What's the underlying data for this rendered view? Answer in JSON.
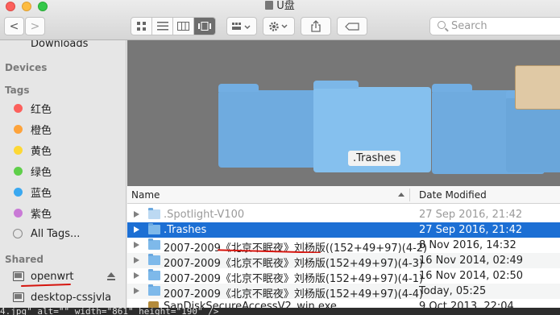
{
  "window": {
    "title": "U盘"
  },
  "toolbar": {
    "back_label": "<",
    "forward_label": ">",
    "search_placeholder": "Search"
  },
  "sidebar": {
    "partial_item": "Downloads",
    "devices_header": "Devices",
    "tags_header": "Tags",
    "tags": [
      {
        "label": "红色",
        "color": "#fc605c"
      },
      {
        "label": "橙色",
        "color": "#fda33b"
      },
      {
        "label": "黄色",
        "color": "#fdd835"
      },
      {
        "label": "绿色",
        "color": "#5fcf4a"
      },
      {
        "label": "蓝色",
        "color": "#3aa8f0"
      },
      {
        "label": "紫色",
        "color": "#c97ad6"
      }
    ],
    "all_tags": "All Tags...",
    "shared_header": "Shared",
    "shared": [
      {
        "label": "openwrt"
      },
      {
        "label": "desktop-cssjvla"
      }
    ]
  },
  "coverflow": {
    "selected_label": ".Trashes"
  },
  "list": {
    "columns": {
      "name": "Name",
      "date": "Date Modified"
    },
    "rows": [
      {
        "name": ".Spotlight-V100",
        "date": "27 Sep 2016, 21:42"
      },
      {
        "name": ".Trashes",
        "date": "27 Sep 2016, 21:42"
      },
      {
        "name": "2007-2009《北京不眠夜》刘杨版((152+49+97)(4-2)",
        "date": "8 Nov 2016, 14:32"
      },
      {
        "name": "2007-2009《北京不眠夜》刘杨版(152+49+97)(4-3)",
        "date": "16 Nov 2014, 02:49"
      },
      {
        "name": "2007-2009《北京不眠夜》刘杨版(152+49+97)(4-1)",
        "date": "16 Nov 2014, 02:50"
      },
      {
        "name": "2007-2009《北京不眠夜》刘杨版(152+49+97)(4-4)",
        "date": "Today, 05:25"
      },
      {
        "name": "SanDiskSecureAccessV2_win.exe",
        "date": "9 Oct 2013, 22:04"
      }
    ]
  },
  "overlay_text": "4.jpg\" alt=\"\" width=\"861\" height=\"190\" />"
}
